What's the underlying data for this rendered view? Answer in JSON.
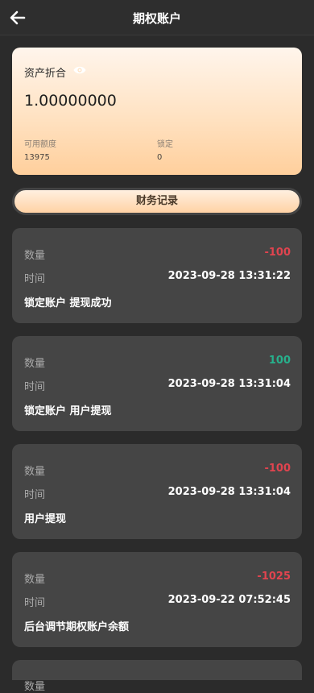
{
  "header": {
    "title": "期权账户"
  },
  "asset": {
    "label": "资产折合",
    "value": "1.00000000",
    "available_label": "可用额度",
    "available_value": "13975",
    "locked_label": "锁定",
    "locked_value": "0"
  },
  "records_button": "财务记录",
  "colors": {
    "negative": "#e0444f",
    "positive": "#27b08c",
    "card_accent": "#ffd2a5"
  },
  "icons": {
    "back": "arrow-left-icon",
    "eye": "eye-icon"
  },
  "records": [
    {
      "qty_label": "数量",
      "qty": "-100",
      "time_label": "时间",
      "time": "2023-09-28 13:31:22",
      "desc": "锁定账户 提现成功"
    },
    {
      "qty_label": "数量",
      "qty": "100",
      "time_label": "时间",
      "time": "2023-09-28 13:31:04",
      "desc": "锁定账户 用户提现"
    },
    {
      "qty_label": "数量",
      "qty": "-100",
      "time_label": "时间",
      "time": "2023-09-28 13:31:04",
      "desc": "用户提现"
    },
    {
      "qty_label": "数量",
      "qty": "-1025",
      "time_label": "时间",
      "time": "2023-09-22 07:52:45",
      "desc": "后台调节期权账户余额"
    },
    {
      "qty_label": "数量",
      "qty": "",
      "time_label": "",
      "time": "",
      "desc": ""
    }
  ]
}
